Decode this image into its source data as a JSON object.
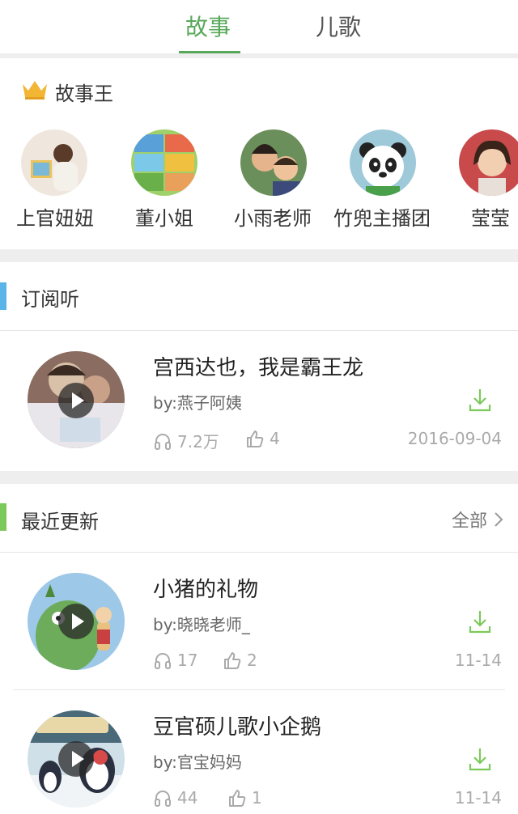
{
  "tabs": [
    {
      "label": "故事",
      "active": true
    },
    {
      "label": "儿歌",
      "active": false
    }
  ],
  "kings": {
    "title": "故事王",
    "anchors": [
      {
        "name": "上官妞妞"
      },
      {
        "name": "董小姐"
      },
      {
        "name": "小雨老师"
      },
      {
        "name": "竹兜主播团"
      },
      {
        "name": "莹莹"
      }
    ]
  },
  "subscribe": {
    "title": "订阅听",
    "accent": "#5ab4e8",
    "items": [
      {
        "title": "宫西达也，我是霸王龙",
        "author": "by:燕子阿姨",
        "plays": "7.2万",
        "likes": "4",
        "date": "2016-09-04"
      }
    ]
  },
  "recent": {
    "title": "最近更新",
    "accent": "#7cc95a",
    "more_label": "全部",
    "items": [
      {
        "title": "小猪的礼物",
        "author": "by:晓晓老师_",
        "plays": "17",
        "likes": "2",
        "date": "11-14"
      },
      {
        "title": "豆官硕儿歌小企鹅",
        "author": "by:官宝妈妈",
        "plays": "44",
        "likes": "1",
        "date": "11-14"
      }
    ]
  },
  "colors": {
    "brand_green": "#58a85a",
    "crown": "#f2b534"
  },
  "icons": [
    "crown-icon",
    "play-icon",
    "headphones-icon",
    "thumbs-up-icon",
    "download-icon",
    "chevron-right-icon"
  ]
}
